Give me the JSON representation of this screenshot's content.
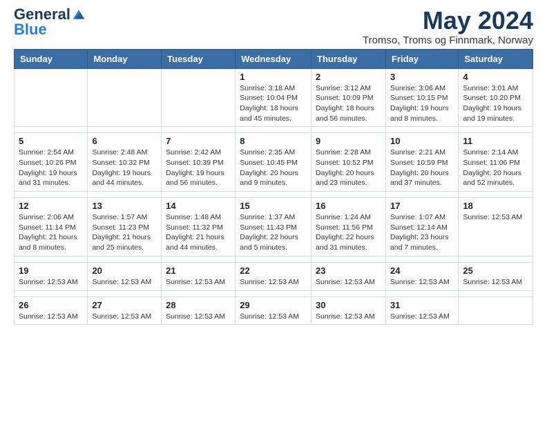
{
  "logo": {
    "general": "General",
    "blue": "Blue"
  },
  "header": {
    "month_year": "May 2024",
    "location": "Tromso, Troms og Finnmark, Norway"
  },
  "columns": [
    "Sunday",
    "Monday",
    "Tuesday",
    "Wednesday",
    "Thursday",
    "Friday",
    "Saturday"
  ],
  "weeks": [
    {
      "days": [
        {
          "num": "",
          "info": ""
        },
        {
          "num": "",
          "info": ""
        },
        {
          "num": "",
          "info": ""
        },
        {
          "num": "1",
          "info": "Sunrise: 3:18 AM\nSunset: 10:04 PM\nDaylight: 18 hours and 45 minutes."
        },
        {
          "num": "2",
          "info": "Sunrise: 3:12 AM\nSunset: 10:09 PM\nDaylight: 18 hours and 56 minutes."
        },
        {
          "num": "3",
          "info": "Sunrise: 3:06 AM\nSunset: 10:15 PM\nDaylight: 19 hours and 8 minutes."
        },
        {
          "num": "4",
          "info": "Sunrise: 3:01 AM\nSunset: 10:20 PM\nDaylight: 19 hours and 19 minutes."
        }
      ]
    },
    {
      "days": [
        {
          "num": "5",
          "info": "Sunrise: 2:54 AM\nSunset: 10:26 PM\nDaylight: 19 hours and 31 minutes."
        },
        {
          "num": "6",
          "info": "Sunrise: 2:48 AM\nSunset: 10:32 PM\nDaylight: 19 hours and 44 minutes."
        },
        {
          "num": "7",
          "info": "Sunrise: 2:42 AM\nSunset: 10:39 PM\nDaylight: 19 hours and 56 minutes."
        },
        {
          "num": "8",
          "info": "Sunrise: 2:35 AM\nSunset: 10:45 PM\nDaylight: 20 hours and 9 minutes."
        },
        {
          "num": "9",
          "info": "Sunrise: 2:28 AM\nSunset: 10:52 PM\nDaylight: 20 hours and 23 minutes."
        },
        {
          "num": "10",
          "info": "Sunrise: 2:21 AM\nSunset: 10:59 PM\nDaylight: 20 hours and 37 minutes."
        },
        {
          "num": "11",
          "info": "Sunrise: 2:14 AM\nSunset: 11:06 PM\nDaylight: 20 hours and 52 minutes."
        }
      ]
    },
    {
      "days": [
        {
          "num": "12",
          "info": "Sunrise: 2:06 AM\nSunset: 11:14 PM\nDaylight: 21 hours and 8 minutes."
        },
        {
          "num": "13",
          "info": "Sunrise: 1:57 AM\nSunset: 11:23 PM\nDaylight: 21 hours and 25 minutes."
        },
        {
          "num": "14",
          "info": "Sunrise: 1:48 AM\nSunset: 11:32 PM\nDaylight: 21 hours and 44 minutes."
        },
        {
          "num": "15",
          "info": "Sunrise: 1:37 AM\nSunset: 11:43 PM\nDaylight: 22 hours and 5 minutes."
        },
        {
          "num": "16",
          "info": "Sunrise: 1:24 AM\nSunset: 11:56 PM\nDaylight: 22 hours and 31 minutes."
        },
        {
          "num": "17",
          "info": "Sunrise: 1:07 AM\nSunset: 12:14 AM\nDaylight: 23 hours and 7 minutes."
        },
        {
          "num": "18",
          "info": "Sunrise: 12:53 AM"
        }
      ]
    },
    {
      "days": [
        {
          "num": "19",
          "info": "Sunrise: 12:53 AM"
        },
        {
          "num": "20",
          "info": "Sunrise: 12:53 AM"
        },
        {
          "num": "21",
          "info": "Sunrise: 12:53 AM"
        },
        {
          "num": "22",
          "info": "Sunrise: 12:53 AM"
        },
        {
          "num": "23",
          "info": "Sunrise: 12:53 AM"
        },
        {
          "num": "24",
          "info": "Sunrise: 12:53 AM"
        },
        {
          "num": "25",
          "info": "Sunrise: 12:53 AM"
        }
      ]
    },
    {
      "days": [
        {
          "num": "26",
          "info": "Sunrise: 12:53 AM"
        },
        {
          "num": "27",
          "info": "Sunrise: 12:53 AM"
        },
        {
          "num": "28",
          "info": "Sunrise: 12:53 AM"
        },
        {
          "num": "29",
          "info": "Sunrise: 12:53 AM"
        },
        {
          "num": "30",
          "info": "Sunrise: 12:53 AM"
        },
        {
          "num": "31",
          "info": "Sunrise: 12:53 AM"
        },
        {
          "num": "",
          "info": ""
        }
      ]
    }
  ]
}
